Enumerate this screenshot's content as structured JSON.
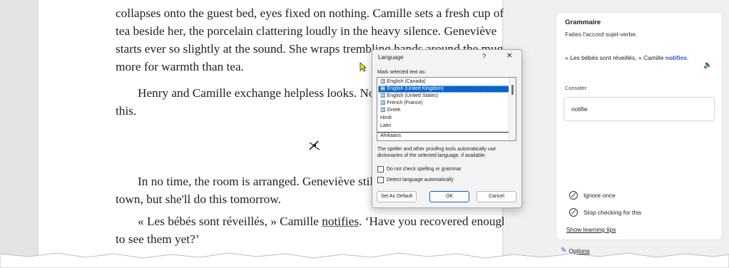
{
  "document": {
    "para1": "collapses onto the guest bed, eyes fixed on nothing. Camille sets a fresh cup of tea beside her, the porcelain clattering loudly in the heavy silence. Geneviève starts ever so slightly at the sound. She wraps trembling hands around the mug, more for warmth than tea.",
    "para2": "Henry and Camille exchange helpless looks. Nothing but help her process this.",
    "para3": "In no time, the room is arranged. Geneviève still has t belonging across town, but she'll do this tomorrow.",
    "para4_pre": "« Les bébés sont réveillés, » Camille ",
    "para4_flag": "notifies",
    "para4_post": ". ‘Have you recovered enough to see them yet?’"
  },
  "language_dialog": {
    "title": "Language",
    "help": "?",
    "close": "✕",
    "mark_label": "Mark selected text as:",
    "languages": [
      {
        "name": "English (Canada)",
        "spell": true,
        "selected": false
      },
      {
        "name": "English (United Kingdom)",
        "spell": true,
        "selected": true
      },
      {
        "name": "English (United States)",
        "spell": true,
        "selected": false
      },
      {
        "name": "French (France)",
        "spell": true,
        "selected": false
      },
      {
        "name": "Greek",
        "spell": true,
        "selected": false
      },
      {
        "name": "Hindi",
        "spell": false,
        "selected": false
      },
      {
        "name": "Latin",
        "spell": false,
        "selected": false
      },
      {
        "name": "Afrikaans",
        "spell": false,
        "selected": false
      }
    ],
    "info": "The speller and other proofing tools automatically use dictionaries of the selected language, if available.",
    "check_no_spell": "Do not check spelling or grammar",
    "check_detect": "Detect language automatically",
    "btn_default": "Set As Default",
    "btn_ok": "OK",
    "btn_cancel": "Cancel"
  },
  "editor_pane": {
    "title": "Grammaire",
    "subtitle": "Faites l'accord sujet-verbe.",
    "example_pre": "« Les bébés sont réveillés, » Camille ",
    "example_flag": "notifies",
    "example_post": ".",
    "consider": "Consider:",
    "suggestion": "notifie",
    "ignore_once": "Ignore once",
    "stop_checking": "Stop checking for this",
    "learning_tips": "Show learning tips",
    "options": "Options"
  },
  "colors": {
    "accent": "#0a64c8",
    "flag": "#2b57d6"
  }
}
